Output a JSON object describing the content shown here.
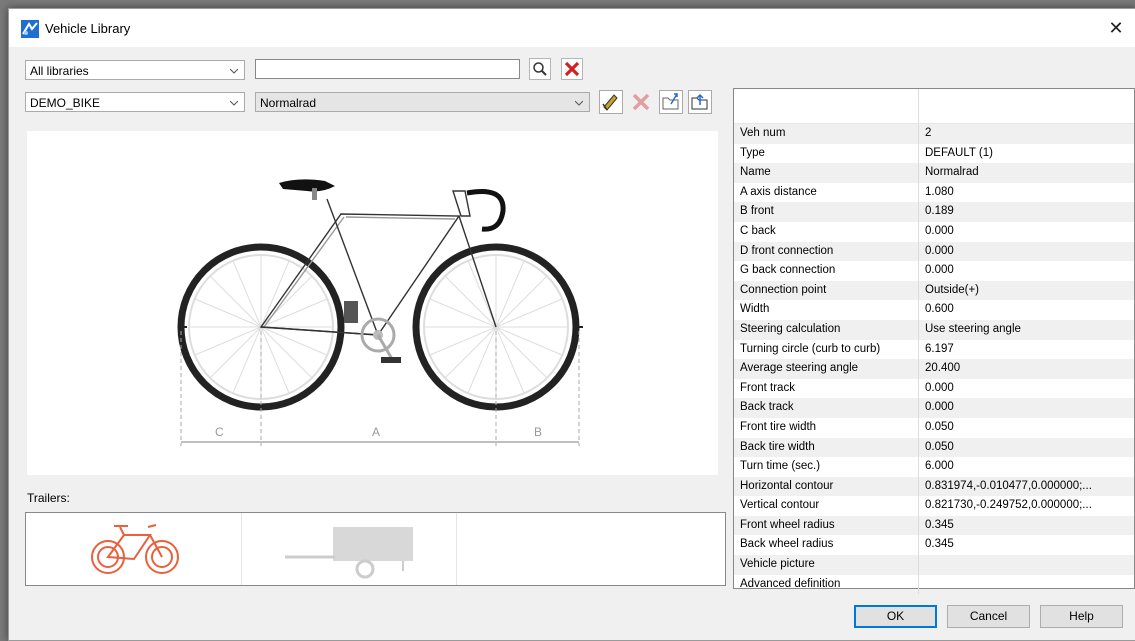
{
  "window": {
    "title": "Vehicle Library"
  },
  "filters": {
    "library": "All libraries",
    "search_value": "",
    "vehicle_set": "DEMO_BIKE",
    "vehicle": "Normalrad"
  },
  "trailers": {
    "label": "Trailers:"
  },
  "diagram": {
    "labels": {
      "c": "C",
      "a": "A",
      "b": "B"
    }
  },
  "properties": [
    {
      "name": "Veh num",
      "value": "2"
    },
    {
      "name": "Type",
      "value": "DEFAULT (1)"
    },
    {
      "name": "Name",
      "value": "Normalrad"
    },
    {
      "name": "A axis distance",
      "value": "1.080"
    },
    {
      "name": "B front",
      "value": "0.189"
    },
    {
      "name": "C back",
      "value": "0.000"
    },
    {
      "name": "D front connection",
      "value": "0.000"
    },
    {
      "name": "G back connection",
      "value": "0.000"
    },
    {
      "name": "Connection point",
      "value": "Outside(+)"
    },
    {
      "name": "Width",
      "value": "0.600"
    },
    {
      "name": "Steering calculation",
      "value": "Use steering angle"
    },
    {
      "name": "Turning circle (curb to curb)",
      "value": "6.197"
    },
    {
      "name": "Average steering angle",
      "value": "20.400"
    },
    {
      "name": "Front track",
      "value": "0.000"
    },
    {
      "name": "Back track",
      "value": "0.000"
    },
    {
      "name": "Front tire width",
      "value": "0.050"
    },
    {
      "name": "Back tire width",
      "value": "0.050"
    },
    {
      "name": "Turn time (sec.)",
      "value": "6.000"
    },
    {
      "name": "Horizontal contour",
      "value": "0.831974,-0.010477,0.000000;..."
    },
    {
      "name": "Vertical contour",
      "value": "0.821730,-0.249752,0.000000;..."
    },
    {
      "name": "Front wheel radius",
      "value": "0.345"
    },
    {
      "name": "Back wheel radius",
      "value": "0.345"
    },
    {
      "name": "Vehicle picture",
      "value": ""
    },
    {
      "name": "Advanced definition",
      "value": ""
    }
  ],
  "buttons": {
    "ok": "OK",
    "cancel": "Cancel",
    "help": "Help"
  },
  "colors": {
    "accent": "#0078d7",
    "delete_red": "#d32020",
    "trailer_orange": "#e8603c"
  }
}
